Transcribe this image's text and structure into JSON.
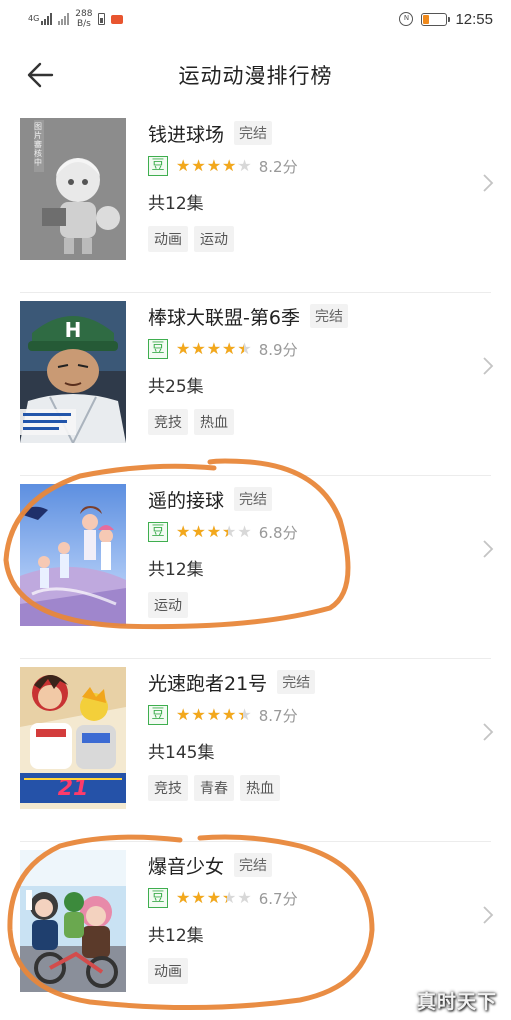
{
  "status_bar": {
    "network": "4G",
    "rate_value": "288",
    "rate_unit": "B/s",
    "time": "12:55",
    "alarm_badge": "N"
  },
  "header": {
    "title": "运动动漫排行榜",
    "back_icon": "back-arrow-icon"
  },
  "rating_source_label": "豆",
  "items": [
    {
      "title": "钱进球场",
      "status": "完结",
      "rating": 8.2,
      "score_text": "8.2分",
      "episodes": "共12集",
      "tags": [
        "动画",
        "运动"
      ],
      "poster_caption": "图片審核中"
    },
    {
      "title": "棒球大联盟-第6季",
      "status": "完结",
      "rating": 8.9,
      "score_text": "8.9分",
      "episodes": "共25集",
      "tags": [
        "竞技",
        "热血"
      ],
      "poster_caption": ""
    },
    {
      "title": "遥的接球",
      "status": "完结",
      "rating": 6.8,
      "score_text": "6.8分",
      "episodes": "共12集",
      "tags": [
        "运动"
      ],
      "poster_caption": ""
    },
    {
      "title": "光速跑者21号",
      "status": "完结",
      "rating": 8.7,
      "score_text": "8.7分",
      "episodes": "共145集",
      "tags": [
        "竞技",
        "青春",
        "热血"
      ],
      "poster_caption": ""
    },
    {
      "title": "爆音少女",
      "status": "完结",
      "rating": 6.7,
      "score_text": "6.7分",
      "episodes": "共12集",
      "tags": [
        "动画"
      ],
      "poster_caption": ""
    }
  ],
  "watermark": "真时天下",
  "colors": {
    "star": "#f3a81c",
    "douban_green": "#3fae4f",
    "annotation": "#e8873a"
  }
}
